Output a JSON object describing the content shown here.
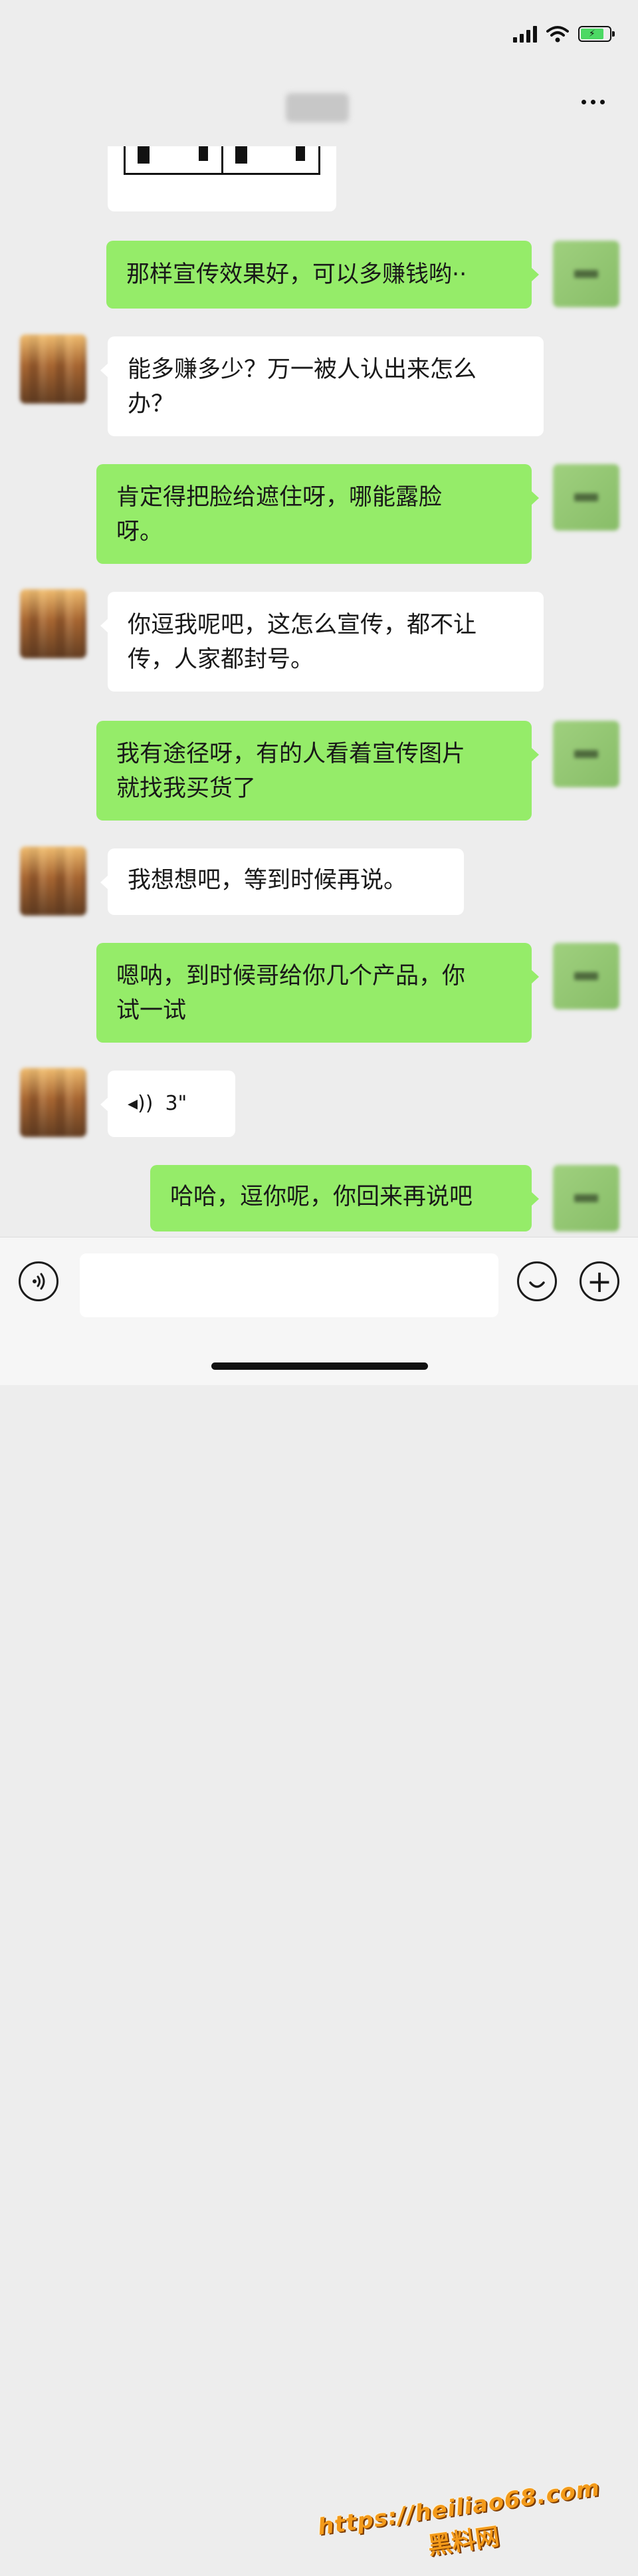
{
  "header": {
    "contact_name": "",
    "more_icon": "more-dots-icon"
  },
  "status_bar": {
    "icons": [
      "signal-icon",
      "wifi-icon",
      "battery-icon"
    ],
    "battery_level": 0.8
  },
  "messages": [
    {
      "sender": "other",
      "type": "image"
    },
    {
      "sender": "self",
      "type": "text",
      "text": "那样宣传效果好，可以多赚钱哟··"
    },
    {
      "sender": "other",
      "type": "text",
      "lines": [
        "能多赚多少？万一被人认出来怎么",
        "办？"
      ]
    },
    {
      "sender": "self",
      "type": "text",
      "lines": [
        "肯定得把脸给遮住呀，哪能露脸",
        "呀。"
      ]
    },
    {
      "sender": "other",
      "type": "text",
      "lines": [
        "你逗我呢吧，这怎么宣传，都不让",
        "传，人家都封号。"
      ]
    },
    {
      "sender": "self",
      "type": "text",
      "lines": [
        "我有途径呀，有的人看着宣传图片",
        "就找我买货了"
      ]
    },
    {
      "sender": "other",
      "type": "text",
      "text": "我想想吧，等到时候再说。"
    },
    {
      "sender": "self",
      "type": "text",
      "lines": [
        "嗯呐，到时候哥给你几个产品，你",
        "试一试"
      ]
    },
    {
      "sender": "other",
      "type": "voice",
      "duration": "3\""
    },
    {
      "sender": "self",
      "type": "text",
      "text": "哈哈，逗你呢，你回来再说吧"
    }
  ],
  "input_bar": {
    "voice_icon": "voice-input-icon",
    "emoji_icon": "emoji-icon",
    "plus_icon": "plus-icon",
    "message_value": ""
  },
  "watermark": {
    "url": "https://heiliao68.com",
    "name": "黑料网"
  },
  "colors": {
    "background": "#ededed",
    "self_bubble": "#95ec69",
    "other_bubble": "#ffffff"
  }
}
